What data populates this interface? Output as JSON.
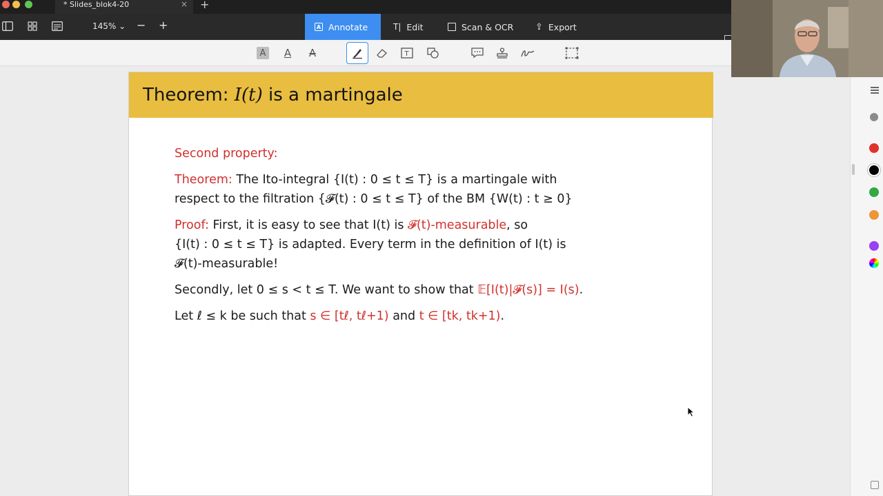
{
  "window": {
    "tab_title": "* Slides_blok4-20",
    "tab_close": "×",
    "new_tab": "+"
  },
  "toolbar": {
    "zoom_level": "145%",
    "zoom_chevron": "⌄",
    "zoom_out": "−",
    "zoom_in": "+",
    "modes": [
      {
        "label": "Annotate",
        "icon": "annotate-icon",
        "active": true
      },
      {
        "label": "Edit",
        "icon": "text-cursor-icon",
        "active": false
      },
      {
        "label": "Scan & OCR",
        "icon": "scan-icon",
        "active": false
      },
      {
        "label": "Export",
        "icon": "export-icon",
        "active": false
      }
    ]
  },
  "annotation_tools": [
    {
      "name": "highlight-text-icon",
      "glyph": "A"
    },
    {
      "name": "underline-text-icon",
      "glyph": "A"
    },
    {
      "name": "strikethrough-text-icon",
      "glyph": "A"
    },
    {
      "name": "highlighter-pen-icon",
      "glyph": "✎",
      "selected": true
    },
    {
      "name": "eraser-icon",
      "glyph": "⌫"
    },
    {
      "name": "text-box-icon",
      "glyph": "T"
    },
    {
      "name": "shapes-icon",
      "glyph": "◱"
    },
    {
      "name": "comment-icon",
      "glyph": "💬"
    },
    {
      "name": "stamp-icon",
      "glyph": "⊥"
    },
    {
      "name": "signature-icon",
      "glyph": "✍"
    },
    {
      "name": "selection-icon",
      "glyph": "⬚"
    }
  ],
  "slide": {
    "title_prefix": "Theorem: ",
    "title_math": "I(t)",
    "title_suffix": " is a martingale",
    "header_color": "#e9bd3f",
    "section": "Second property:",
    "theorem_label": "Theorem:",
    "theorem_line1": " The Ito-integral {I(t) : 0 ≤ t ≤ T} is a martingale with",
    "theorem_line2": "respect to the filtration {𝓕(t) : 0 ≤ t ≤ T} of the BM {W(t) : t ≥ 0}",
    "proof_label": "Proof:",
    "proof_line1_a": " First, it is easy to see that I(t) is ",
    "proof_line1_red": "𝓕(t)-measurable",
    "proof_line1_b": ", so",
    "proof_line2": "{I(t) : 0 ≤ t ≤ T} is adapted. Every term in the definition of I(t) is",
    "proof_line3": "𝓕(t)-measurable!",
    "secondly_a": "Secondly, let 0 ≤ s < t ≤ T. We want to show that ",
    "secondly_red": "𝔼[I(t)|𝓕(s)] = I(s)",
    "secondly_b": ".",
    "let_a": "Let ℓ ≤ k be such that ",
    "let_red1": "s ∈ [tℓ, tℓ+1)",
    "let_b": " and ",
    "let_red2": "t ∈ [tk, tk+1)",
    "let_c": "."
  },
  "side_panel": {
    "colors": [
      "#888888",
      "#e0322c",
      "#000000",
      "#34a845",
      "#f0943a",
      "#9b3ff0"
    ]
  },
  "colors": {
    "accent": "#3d8ef0",
    "red_text": "#d0312d"
  }
}
